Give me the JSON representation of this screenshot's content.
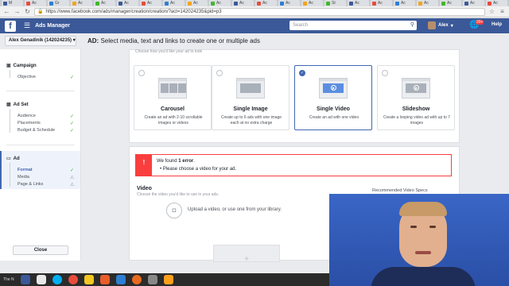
{
  "browser": {
    "tabs": [
      "M",
      "Ac",
      "Gr",
      "Ac",
      "Ac",
      "Ac",
      "Ac",
      "Ac",
      "Ac",
      "Ac",
      "Ac",
      "Ac",
      "Ac",
      "Ac",
      "St",
      "Ac",
      "Ac",
      "Ac",
      "Ac",
      "Ac",
      "Ac",
      "Ac"
    ],
    "url": "https://www.facebook.com/ads/manager/creation/creation/?act=142024235&pid=p3"
  },
  "fbbar": {
    "app_title": "Ads Manager",
    "search_placeholder": "Search",
    "user_name": "Alex",
    "notif_count": "20+",
    "help_label": "Help"
  },
  "account_selector": "Alex Genadinik (142024235)",
  "headline": {
    "prefix": "AD:",
    "text": "Select media, text and links to create one or multiple ads"
  },
  "sidebar": {
    "campaign": {
      "title": "Campaign",
      "items": [
        "Objective"
      ]
    },
    "adset": {
      "title": "Ad Set",
      "items": [
        "Audience",
        "Placements",
        "Budget & Schedule"
      ]
    },
    "ad": {
      "title": "Ad",
      "items": [
        "Format",
        "Media",
        "Page & Links"
      ]
    },
    "close_label": "Close"
  },
  "format": {
    "choose_text": "Choose how you'd like your ad to look",
    "cards": [
      {
        "title": "Carousel",
        "desc": "Create an ad with 2-10 scrollable images or videos",
        "selected": false
      },
      {
        "title": "Single Image",
        "desc": "Create up to 6 ads with one image each at no extra charge",
        "selected": false
      },
      {
        "title": "Single Video",
        "desc": "Create an ad with one video",
        "selected": true
      },
      {
        "title": "Slideshow",
        "desc": "Create a looping video ad with up to 7 images",
        "selected": false
      }
    ]
  },
  "error": {
    "title_prefix": "We found",
    "title_bold": "1 error",
    "item": "Please choose a video for your ad."
  },
  "video": {
    "label": "Video",
    "sub": "Choose the video you'd like to use in your ads.",
    "upload_text": "Upload a video, or use one from your library.",
    "rec_specs": "Recommended Video Specs"
  },
  "taskbar": {
    "text": "The N"
  },
  "colors": {
    "fb_blue": "#3b5998",
    "error_red": "#fa3e3e",
    "check_green": "#42b72a"
  }
}
